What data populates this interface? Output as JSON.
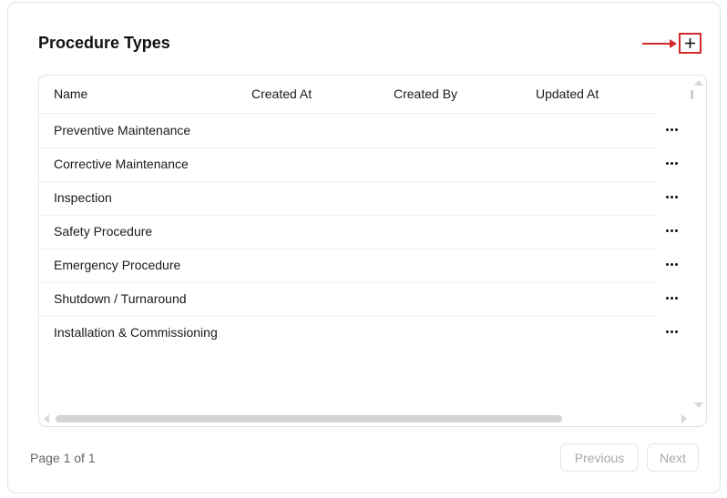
{
  "card": {
    "title": "Procedure Types"
  },
  "table": {
    "columns": [
      "Name",
      "Created At",
      "Created By",
      "Updated At"
    ],
    "rows": [
      {
        "name": "Preventive Maintenance"
      },
      {
        "name": "Corrective Maintenance"
      },
      {
        "name": "Inspection"
      },
      {
        "name": "Safety Procedure"
      },
      {
        "name": "Emergency Procedure"
      },
      {
        "name": "Shutdown / Turnaround"
      },
      {
        "name": "Installation & Commissioning"
      }
    ]
  },
  "pagination": {
    "page_info": "Page 1 of 1",
    "previous_label": "Previous",
    "next_label": "Next"
  },
  "colors": {
    "annotation_red": "#d42a2a",
    "border": "#e3e3e3",
    "disabled_text": "#a8a8a8"
  },
  "icons": {
    "add": "plus-icon",
    "annotation": "arrow-right-icon",
    "row_menu": "more-horizontal-icon"
  }
}
